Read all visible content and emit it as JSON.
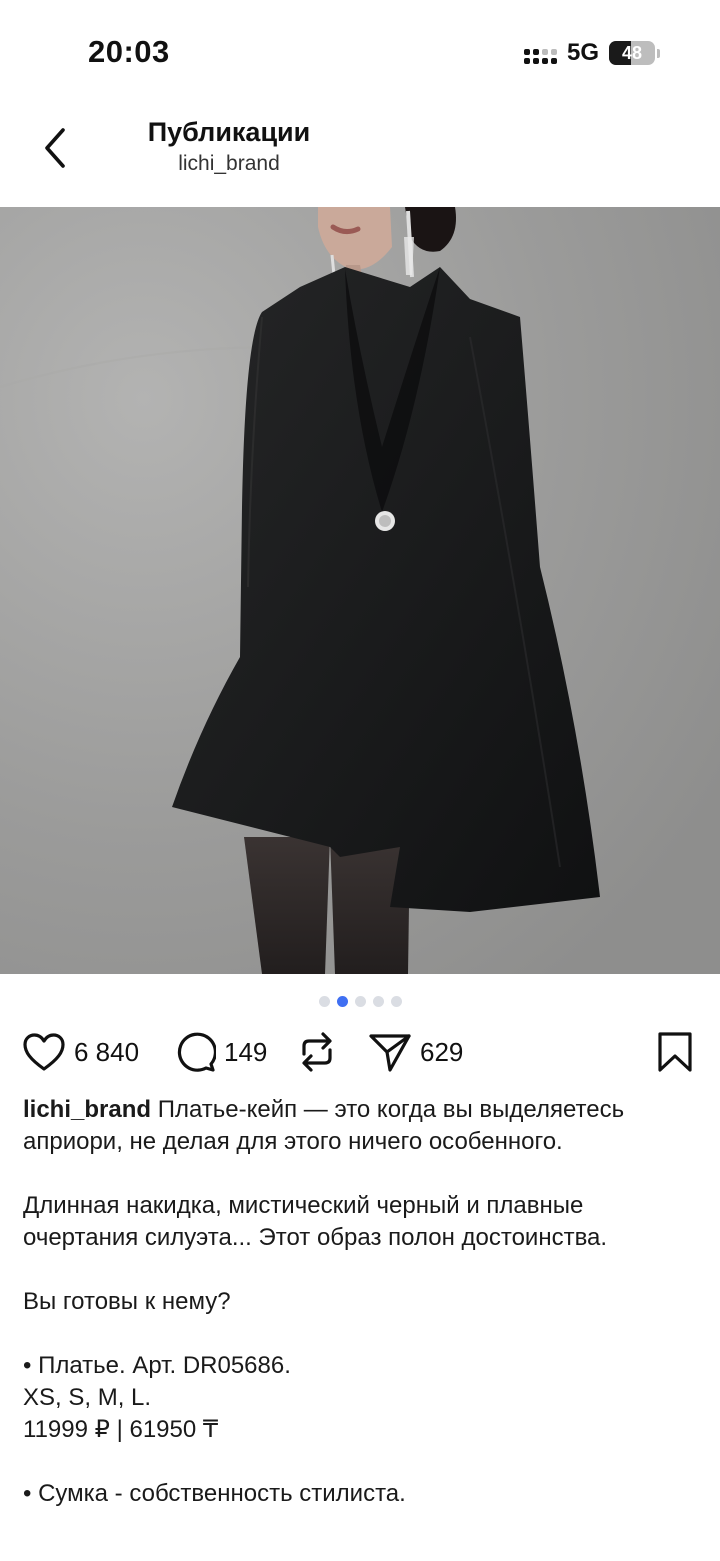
{
  "status_bar": {
    "time": "20:03",
    "network": "5G",
    "battery": "48"
  },
  "header": {
    "title": "Публикации",
    "subtitle": "lichi_brand",
    "back_icon": "chevron-left-icon"
  },
  "post": {
    "image_description_icon": "photo",
    "carousel": {
      "count": 5,
      "active_index": 1
    },
    "actions": {
      "likes": "6 840",
      "comments": "149",
      "shares": "629"
    },
    "caption": {
      "username": "lichi_brand",
      "lines": [
        "Платье-кейп — это когда вы выделяетесь априори, не делая для этого ничего особенного.",
        "",
        "Длинная накидка, мистический черный и плавные очертания силуэта... Этот образ полон достоинства.",
        "",
        "Вы готовы к нему?",
        "",
        "• Платье. Арт. DR05686.",
        "XS, S, M, L.",
        "11999 ₽ | 61950 ₸",
        "",
        "• Сумка - собственность стилиста."
      ]
    }
  },
  "colors": {
    "accent_dot": "#3f6ff2",
    "background": "#ffffff",
    "photo_bg": "#9c9c9b"
  }
}
